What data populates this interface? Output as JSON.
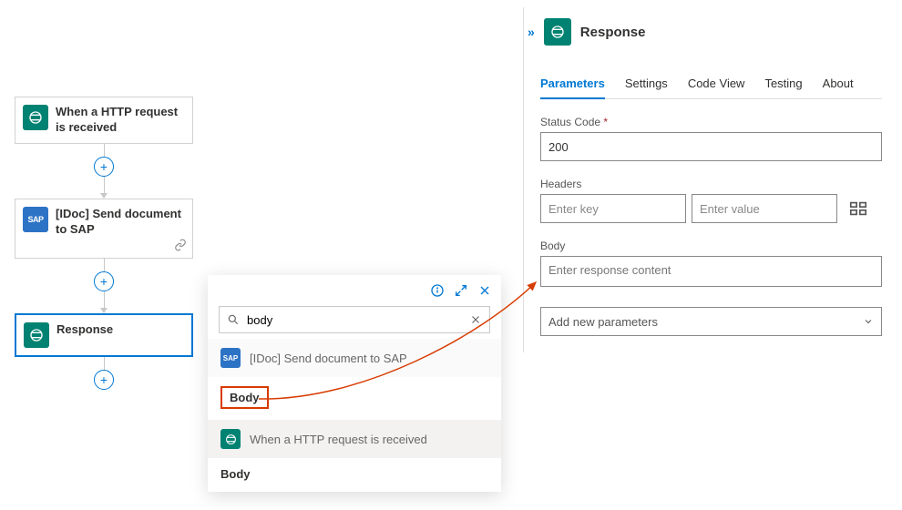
{
  "workflow": {
    "step1": {
      "label": "When a HTTP request is received"
    },
    "step2": {
      "label": "[IDoc] Send document to SAP"
    },
    "step3": {
      "label": "Response"
    }
  },
  "picker": {
    "search_value": "body",
    "group1": {
      "title": "[IDoc] Send document to SAP"
    },
    "item1": "Body",
    "group2": {
      "title": "When a HTTP request is received"
    },
    "item2": "Body"
  },
  "pane": {
    "title": "Response",
    "tabs": {
      "parameters": "Parameters",
      "settings": "Settings",
      "codeview": "Code View",
      "testing": "Testing",
      "about": "About"
    },
    "fields": {
      "status_label": "Status Code",
      "status_value": "200",
      "headers_label": "Headers",
      "headers_key_placeholder": "Enter key",
      "headers_val_placeholder": "Enter value",
      "body_label": "Body",
      "body_placeholder": "Enter response content",
      "addparam_label": "Add new parameters"
    }
  }
}
